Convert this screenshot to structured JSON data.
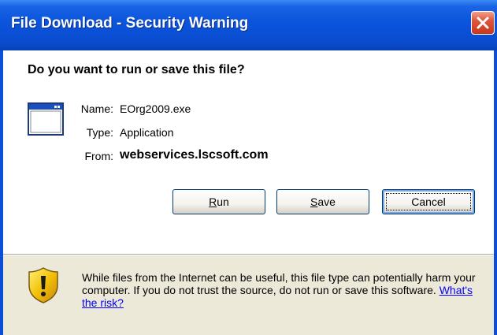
{
  "window": {
    "title": "File Download - Security Warning"
  },
  "dialog": {
    "question": "Do you want to run or save this file?",
    "file": {
      "name_label": "Name:",
      "name_value": "EOrg2009.exe",
      "type_label": "Type:",
      "type_value": "Application",
      "from_label": "From:",
      "from_value": "webservices.lscsoft.com"
    },
    "buttons": {
      "run": {
        "accel": "R",
        "rest": "un"
      },
      "save": {
        "accel": "S",
        "rest": "ave"
      },
      "cancel": "Cancel"
    },
    "warning": {
      "text": "While files from the Internet can be useful, this file type can potentially harm your computer. If you do not trust the source, do not run or save this software.",
      "link": "What's the risk?"
    }
  },
  "icons": {
    "close": "close-icon",
    "application": "application-window-icon",
    "warning": "security-shield-icon"
  },
  "colors": {
    "titlebar": "#0a4cd0",
    "close_button": "#e0553a",
    "dialog_body": "#ece9d8",
    "header_bg": "#ffffff",
    "link": "#0000ff",
    "shield_yellow": "#f2c10a"
  }
}
